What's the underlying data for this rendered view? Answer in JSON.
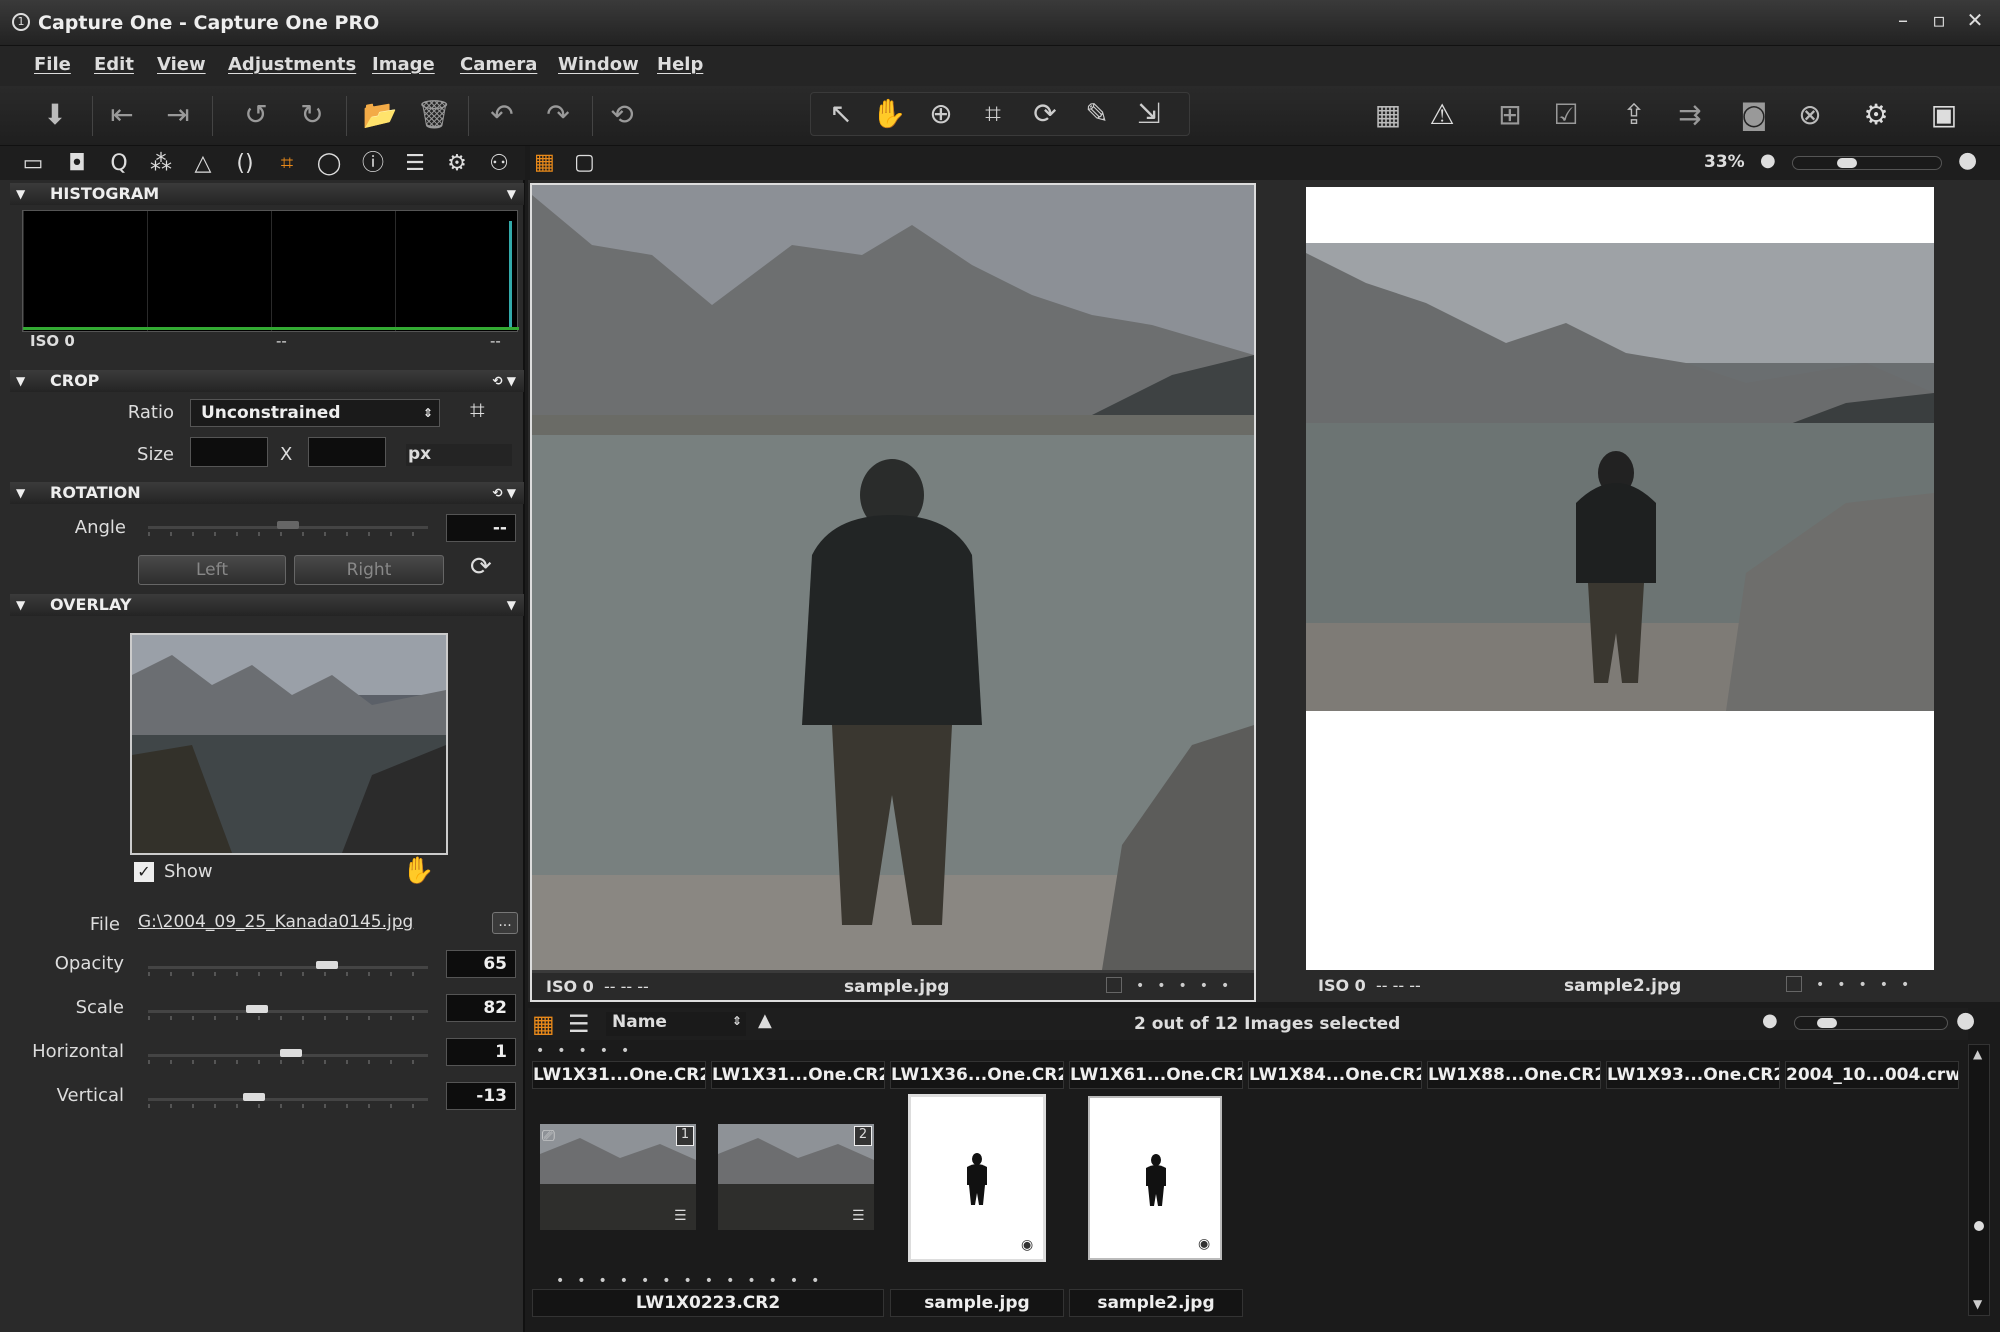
{
  "window": {
    "title": "Capture One - Capture One PRO"
  },
  "menu": [
    "File",
    "Edit",
    "View",
    "Adjustments",
    "Image",
    "Camera",
    "Window",
    "Help"
  ],
  "view": {
    "zoom": "33%"
  },
  "histogram": {
    "header": "HISTOGRAM",
    "iso": "ISO 0",
    "mid": "--",
    "right": "--"
  },
  "crop": {
    "header": "CROP",
    "ratio_label": "Ratio",
    "ratio_value": "Unconstrained",
    "size_label": "Size",
    "x_label": "X",
    "unit": "px"
  },
  "rotation": {
    "header": "ROTATION",
    "angle_label": "Angle",
    "angle_value": "--",
    "left_label": "Left",
    "right_label": "Right"
  },
  "overlay": {
    "header": "OVERLAY",
    "show_label": "Show",
    "file_label": "File",
    "file_value": "G:\\2004_09_25_Kanada0145.jpg",
    "browse": "...",
    "sliders": [
      {
        "label": "Opacity",
        "value": "65",
        "level": 0.65
      },
      {
        "label": "Scale",
        "value": "82",
        "level": 0.38
      },
      {
        "label": "Horizontal",
        "value": "1",
        "level": 0.51
      },
      {
        "label": "Vertical",
        "value": "-13",
        "level": 0.37
      }
    ]
  },
  "viewer": {
    "left": {
      "iso": "ISO 0",
      "meta": "--  --  --",
      "filename": "sample.jpg"
    },
    "right": {
      "iso": "ISO 0",
      "meta": "--  --  --",
      "filename": "sample2.jpg"
    }
  },
  "browser": {
    "sort": "Name",
    "status": "2 out of 12 Images selected",
    "names": [
      "LW1X31...One.CR2",
      "LW1X31...One.CR2",
      "LW1X36...One.CR2",
      "LW1X61...One.CR2",
      "LW1X84...One.CR2",
      "LW1X88...One.CR2",
      "LW1X93...One.CR2",
      "2004_10...004.crw"
    ],
    "thumbs": [
      {
        "badge": "1"
      },
      {
        "badge": "2"
      }
    ],
    "bottom_names": [
      "LW1X0223.CR2",
      "sample.jpg",
      "sample2.jpg"
    ]
  },
  "colors": {
    "accent": "#e8891a",
    "panel": "#2a2a2a",
    "background": "#1b1b1b"
  }
}
